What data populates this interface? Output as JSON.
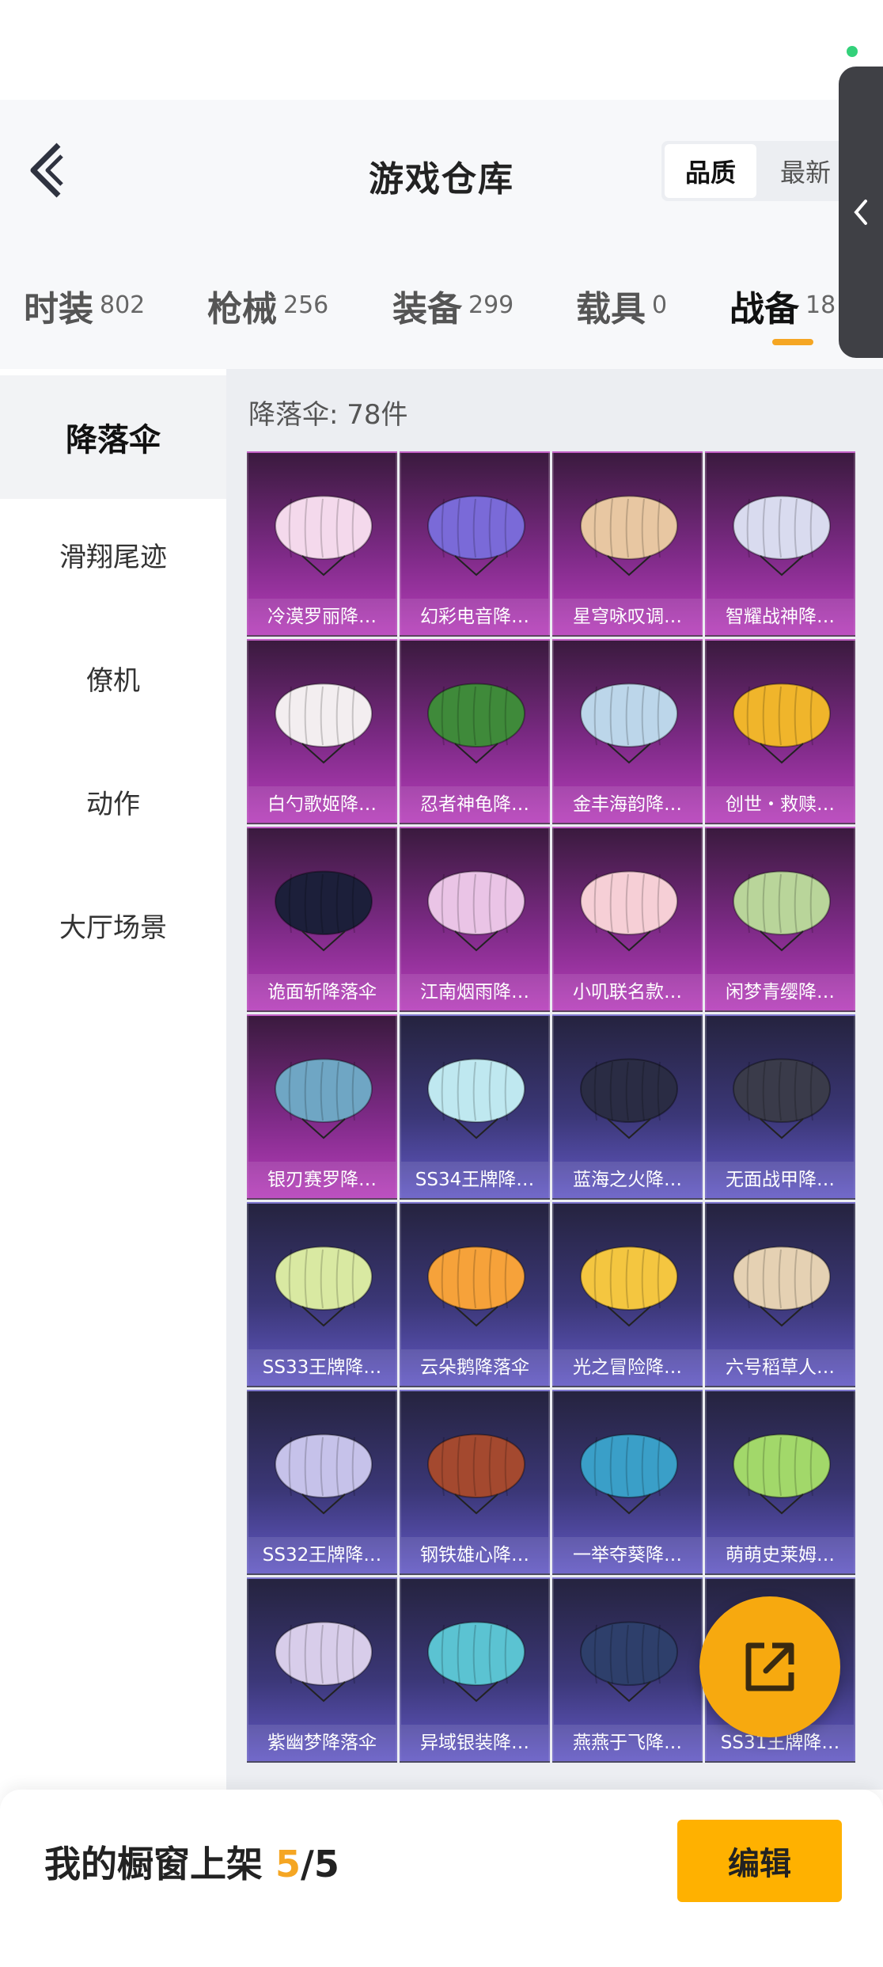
{
  "header": {
    "title": "游戏仓库",
    "sort_options": [
      "品质",
      "最新"
    ],
    "active_sort": "品质"
  },
  "tabs": [
    {
      "label": "时装",
      "count": "802"
    },
    {
      "label": "枪械",
      "count": "256"
    },
    {
      "label": "装备",
      "count": "299"
    },
    {
      "label": "载具",
      "count": "0"
    },
    {
      "label": "战备",
      "count": "18"
    }
  ],
  "active_tab": "战备",
  "sidebar": {
    "items": [
      {
        "label": "降落伞"
      },
      {
        "label": "滑翔尾迹"
      },
      {
        "label": "僚机"
      },
      {
        "label": "动作"
      },
      {
        "label": "大厅场景"
      }
    ],
    "active": "降落伞"
  },
  "content": {
    "count_label": "降落伞: 78件"
  },
  "items": [
    {
      "name": "冷漠罗丽降…",
      "tier": "purple",
      "color": "#f4d9ec"
    },
    {
      "name": "幻彩电音降…",
      "tier": "purple",
      "color": "#7a6ad8"
    },
    {
      "name": "星穹咏叹调…",
      "tier": "purple",
      "color": "#e8c7a2"
    },
    {
      "name": "智耀战神降…",
      "tier": "purple",
      "color": "#d9dbef"
    },
    {
      "name": "白勺歌姬降…",
      "tier": "purple",
      "color": "#f3eef0"
    },
    {
      "name": "忍者神龟降…",
      "tier": "purple",
      "color": "#3f8a3a"
    },
    {
      "name": "金丰海韵降…",
      "tier": "purple",
      "color": "#bcd6ea"
    },
    {
      "name": "创世・救赎…",
      "tier": "purple",
      "color": "#f0b52b"
    },
    {
      "name": "诡面斩降落伞",
      "tier": "purple",
      "color": "#1c1f3a"
    },
    {
      "name": "江南烟雨降…",
      "tier": "purple",
      "color": "#eac4e6"
    },
    {
      "name": "小叽联名款…",
      "tier": "purple",
      "color": "#f6cfd6"
    },
    {
      "name": "闲梦青缨降…",
      "tier": "purple",
      "color": "#b9d59a"
    },
    {
      "name": "银刃赛罗降…",
      "tier": "purple",
      "color": "#6fa6c4"
    },
    {
      "name": "SS34王牌降…",
      "tier": "blue",
      "color": "#bfe8f0"
    },
    {
      "name": "蓝海之火降…",
      "tier": "blue",
      "color": "#2a2c44"
    },
    {
      "name": "无面战甲降…",
      "tier": "blue",
      "color": "#3a3b4a"
    },
    {
      "name": "SS33王牌降…",
      "tier": "blue",
      "color": "#d9e9a2"
    },
    {
      "name": "云朵鹅降落伞",
      "tier": "blue",
      "color": "#f6a23a"
    },
    {
      "name": "光之冒险降…",
      "tier": "blue",
      "color": "#f4c640"
    },
    {
      "name": "六号稻草人…",
      "tier": "blue",
      "color": "#e5d1b3"
    },
    {
      "name": "SS32王牌降…",
      "tier": "blue",
      "color": "#c6c2ea"
    },
    {
      "name": "钢铁雄心降…",
      "tier": "blue",
      "color": "#a4492f"
    },
    {
      "name": "一举夺葵降…",
      "tier": "blue",
      "color": "#3a9fc8"
    },
    {
      "name": "萌萌史莱姆…",
      "tier": "blue",
      "color": "#a2d86a"
    },
    {
      "name": "紫幽梦降落伞",
      "tier": "blue",
      "color": "#d8cdea"
    },
    {
      "name": "异域银装降…",
      "tier": "blue",
      "color": "#5bc3d2"
    },
    {
      "name": "燕燕于飞降…",
      "tier": "blue",
      "color": "#2e3f6b"
    },
    {
      "name": "SS31王牌降…",
      "tier": "blue",
      "color": "#dde3ee"
    }
  ],
  "bottom": {
    "showcase_label": "我的橱窗上架",
    "showcase_used": "5",
    "showcase_total": "/5",
    "edit_label": "编辑"
  },
  "colors": {
    "accent": "#f5a623",
    "purple_tier": "#b63dba",
    "blue_tier": "#6258c4"
  }
}
